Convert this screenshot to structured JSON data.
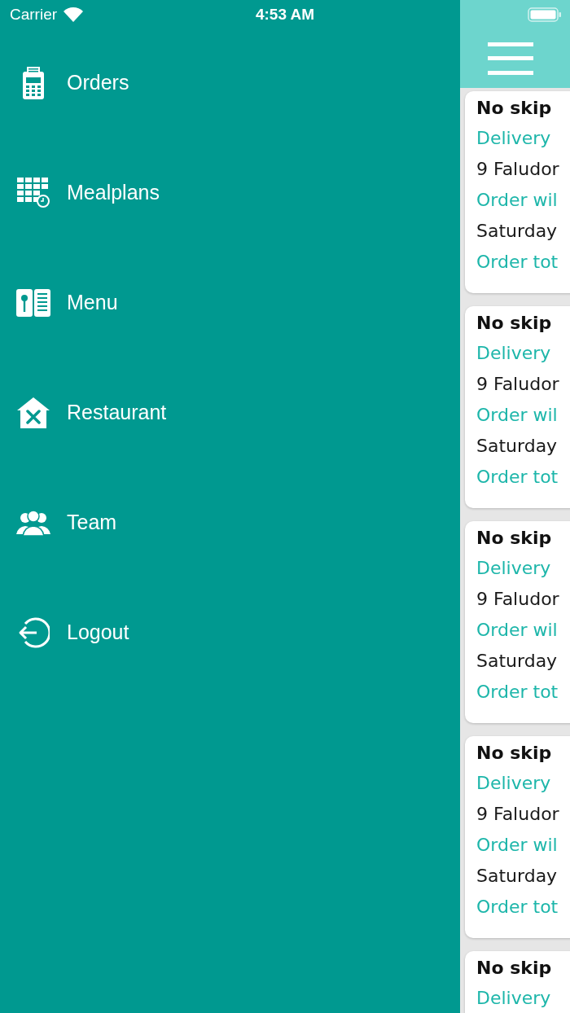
{
  "status_bar": {
    "carrier": "Carrier",
    "time": "4:53 AM"
  },
  "drawer": {
    "items": [
      {
        "label": "Orders",
        "kind": "orders"
      },
      {
        "label": "Mealplans",
        "kind": "mealplans"
      },
      {
        "label": "Menu",
        "kind": "menu"
      },
      {
        "label": "Restaurant",
        "kind": "restaurant"
      },
      {
        "label": "Team",
        "kind": "team"
      },
      {
        "label": "Logout",
        "kind": "logout"
      }
    ]
  },
  "orders": [
    {
      "title": "No skip",
      "lines": [
        {
          "kind": "label",
          "text": "Delivery"
        },
        {
          "kind": "value",
          "text": "9 Faludor"
        },
        {
          "kind": "label",
          "text": "Order wil"
        },
        {
          "kind": "value",
          "text": "Saturday"
        },
        {
          "kind": "label",
          "text": "Order tot"
        }
      ]
    },
    {
      "title": "No skip",
      "lines": [
        {
          "kind": "label",
          "text": "Delivery"
        },
        {
          "kind": "value",
          "text": "9 Faludor"
        },
        {
          "kind": "label",
          "text": "Order wil"
        },
        {
          "kind": "value",
          "text": "Saturday"
        },
        {
          "kind": "label",
          "text": "Order tot"
        }
      ]
    },
    {
      "title": "No skip",
      "lines": [
        {
          "kind": "label",
          "text": "Delivery"
        },
        {
          "kind": "value",
          "text": "9 Faludor"
        },
        {
          "kind": "label",
          "text": "Order wil"
        },
        {
          "kind": "value",
          "text": "Saturday"
        },
        {
          "kind": "label",
          "text": "Order tot"
        }
      ]
    },
    {
      "title": "No skip",
      "lines": [
        {
          "kind": "label",
          "text": "Delivery"
        },
        {
          "kind": "value",
          "text": "9 Faludor"
        },
        {
          "kind": "label",
          "text": "Order wil"
        },
        {
          "kind": "value",
          "text": "Saturday"
        },
        {
          "kind": "label",
          "text": "Order tot"
        }
      ]
    },
    {
      "title": "No skip",
      "lines": [
        {
          "kind": "label",
          "text": "Delivery"
        }
      ]
    }
  ]
}
